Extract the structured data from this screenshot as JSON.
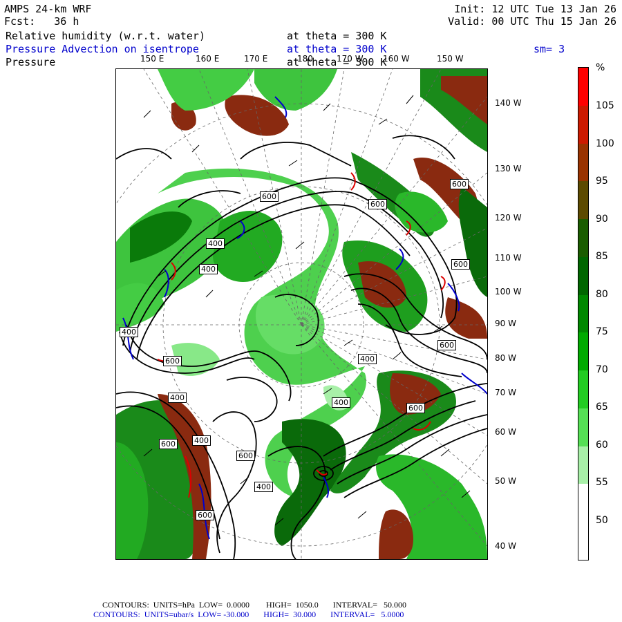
{
  "header": {
    "model": "AMPS 24-km WRF",
    "fcst": "Fcst:   36 h",
    "init": "Init: 12 UTC Tue 13 Jan 26",
    "valid": "Valid: 00 UTC Thu 15 Jan 26",
    "field1_name": "Relative humidity (w.r.t. water)",
    "field1_level": "at theta = 300 K",
    "field2_name": "Pressure Advection on isentrope",
    "field2_level": "at theta = 300 K",
    "field2_smooth": "sm= 3",
    "field3_name": "Pressure",
    "field3_level": "at theta = 300 K"
  },
  "longitude_labels": [
    "150 E",
    "160 E",
    "170 E",
    "180",
    "170 W",
    "160 W",
    "150 W"
  ],
  "latitude_labels": [
    "140 W",
    "130 W",
    "120 W",
    "110 W",
    "100 W",
    "90 W",
    "80 W",
    "70 W",
    "60 W",
    "50 W",
    "40 W"
  ],
  "contour_labels": [
    "600",
    "400",
    "400",
    "600",
    "600",
    "600",
    "600",
    "400",
    "400",
    "400",
    "600",
    "400",
    "600",
    "600",
    "400",
    "600",
    "400",
    "600"
  ],
  "colorbar": {
    "unit": "%",
    "labels": [
      "105",
      "100",
      "95",
      "90",
      "85",
      "80",
      "75",
      "70",
      "65",
      "60",
      "55",
      "50"
    ],
    "colors": [
      "#ff0000",
      "#cc1a00",
      "#993300",
      "#5c4a00",
      "#1a5c00",
      "#006600",
      "#008800",
      "#00aa00",
      "#22cc22",
      "#55e055",
      "#a8f0a8",
      "#ffffff",
      "#ffffff"
    ]
  },
  "footer": {
    "line1": "CONTOURS:  UNITS=hPa  LOW=  0.0000        HIGH=  1050.0       INTERVAL=   50.000",
    "line2": "CONTOURS:  UNITS=ubar/s  LOW= -30.000       HIGH=  30.000       INTERVAL=   5.0000"
  },
  "colors": {
    "rh_light": "#66e066",
    "rh_mid": "#22b022",
    "rh_dark": "#0a6a0a",
    "rh_brown": "#8a2a10",
    "rh_red": "#cc2200",
    "pressure_contour": "#000000",
    "advection_positive": "#dd0000",
    "advection_negative": "#0000cc"
  }
}
